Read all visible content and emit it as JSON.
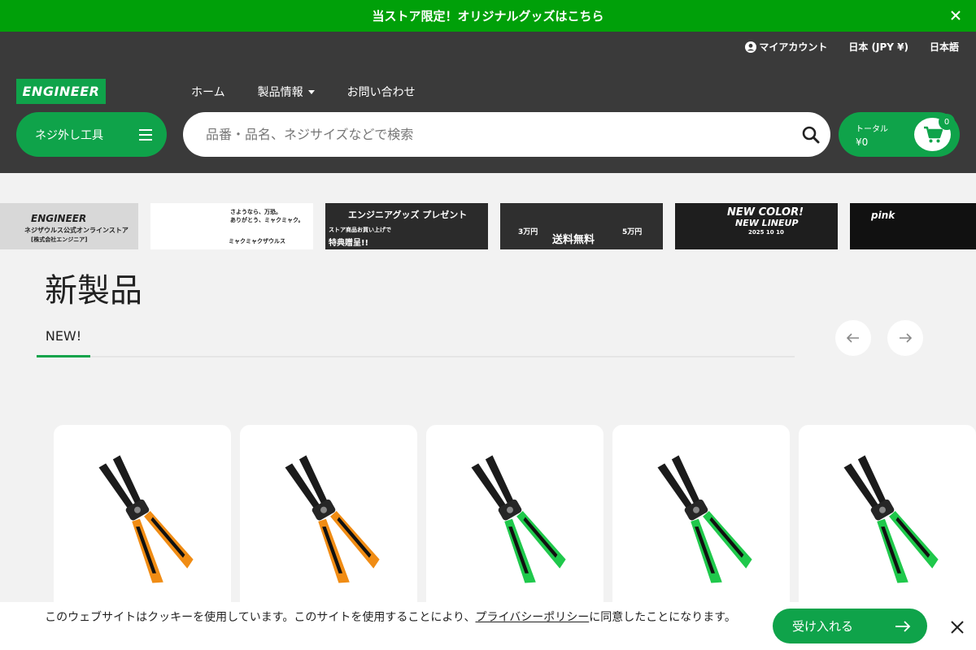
{
  "announcement": {
    "text": "当ストア限定！オリジナルグッズはこちら"
  },
  "util_nav": {
    "account": "マイアカウント",
    "region": "日本 (JPY ¥)",
    "language": "日本語"
  },
  "logo": {
    "text": "ENGINEER"
  },
  "main_nav": {
    "home": "ホーム",
    "products": "製品情報",
    "contact": "お問い合わせ"
  },
  "category_button": {
    "label": "ネジ外し工具"
  },
  "search": {
    "placeholder": "品番・品名、ネジサイズなどで検索",
    "value": ""
  },
  "cart": {
    "total_label": "トータル",
    "total_amount": "¥0",
    "count": "0"
  },
  "banners": [
    {
      "lines": [
        "ENGINEER",
        "ネジザウルス公式オンラインストア",
        "[株式会社エンジニア]"
      ],
      "bg": "#d8d8d8",
      "fg": "#222222"
    },
    {
      "lines": [
        "さようなら、万恐。",
        "ありがとう、ミャクミャク。",
        "ミャクミャクザウルス"
      ],
      "bg": "#ffffff",
      "fg": "#222222"
    },
    {
      "lines": [
        "エンジニアグッズ プレゼント",
        "ストア商品お買い上げで",
        "特典贈呈!!"
      ],
      "bg": "#2b2b2b",
      "fg": "#ffffff"
    },
    {
      "lines": [
        "3万円",
        "送料無料",
        "5万円"
      ],
      "bg": "#2f2f2f",
      "fg": "#ffffff"
    },
    {
      "lines": [
        "NEW COLOR!",
        "NEW LINEUP",
        "2025 10 10"
      ],
      "bg": "#1e1e1e",
      "fg": "#ffffff"
    },
    {
      "lines": [
        "pink",
        "",
        ""
      ],
      "bg": "#111111",
      "fg": "#ffffff"
    }
  ],
  "section": {
    "title": "新製品",
    "tab": "NEW!"
  },
  "products": [
    {
      "accent": "#f08c14"
    },
    {
      "accent": "#f08c14"
    },
    {
      "accent": "#1fc84b"
    },
    {
      "accent": "#1fc84b"
    },
    {
      "accent": "#1fc84b"
    }
  ],
  "cookie": {
    "text_before": "このウェブサイトはクッキーを使用しています。このサイトを使用することにより、",
    "link": "プライバシーポリシー",
    "text_after": "に同意したことになります。",
    "accept": "受け入れる"
  },
  "colors": {
    "brand_green": "#0fa34a",
    "announce_green": "#00a009",
    "header_bg": "#3a3a3a"
  }
}
